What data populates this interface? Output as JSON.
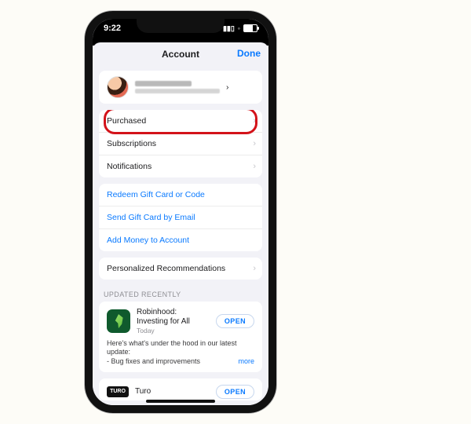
{
  "status": {
    "time": "9:22"
  },
  "header": {
    "title": "Account",
    "done": "Done"
  },
  "menu1": {
    "purchased": "Purchased",
    "subscriptions": "Subscriptions",
    "notifications": "Notifications"
  },
  "menu2": {
    "redeem": "Redeem Gift Card or Code",
    "send": "Send Gift Card by Email",
    "addmoney": "Add Money to Account"
  },
  "menu3": {
    "recs": "Personalized Recommendations"
  },
  "updates": {
    "header": "UPDATED RECENTLY",
    "open_label": "OPEN",
    "items": [
      {
        "name": "Robinhood: Investing for All",
        "date": "Today",
        "notes": "Here's what's under the hood in our latest update:\n- Bug fixes and improvements",
        "more": "more"
      },
      {
        "name": "Turo",
        "date": ""
      }
    ]
  }
}
